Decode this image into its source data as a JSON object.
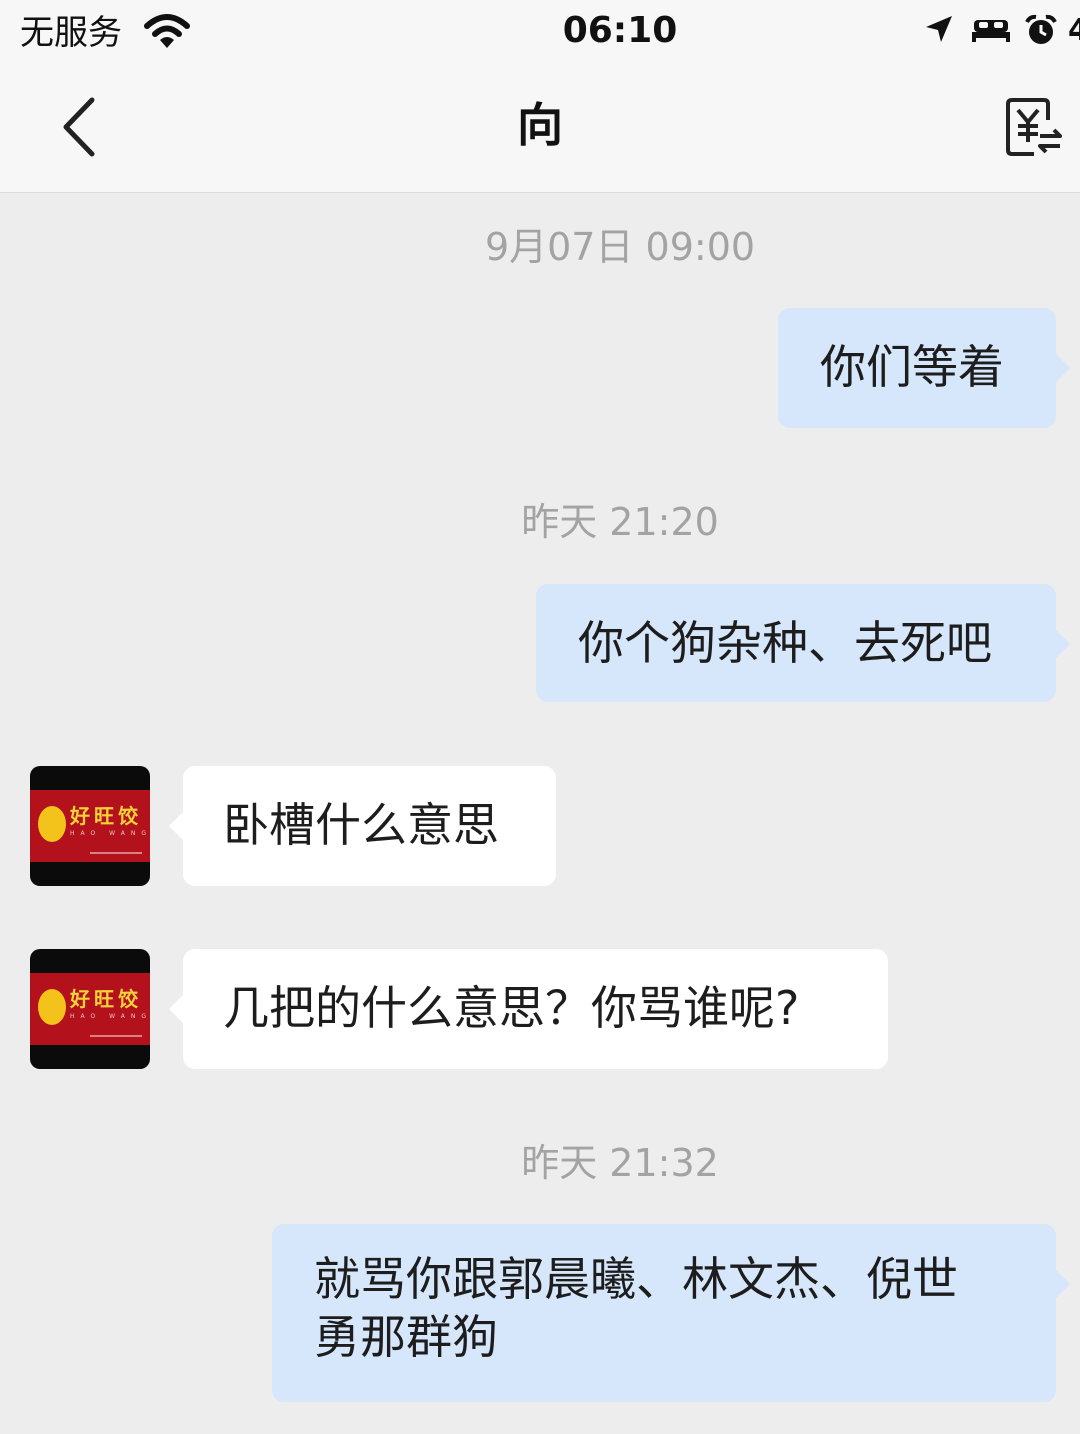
{
  "status_bar": {
    "carrier": "无服务",
    "time": "06:10",
    "wifi_icon": "wifi-icon",
    "location_icon": "location-arrow-icon",
    "sleep_icon": "bed-icon",
    "alarm_icon": "alarm-clock-icon"
  },
  "nav": {
    "back_icon": "chevron-left-icon",
    "title": "向",
    "transfer_icon": "yuan-transfer-icon"
  },
  "colors": {
    "background": "#ededed",
    "bar_background": "#f7f7f7",
    "outgoing_bubble": "#d6e6fb",
    "incoming_bubble": "#ffffff",
    "timestamp_text": "#a3a3a3",
    "avatar_red": "#b3121c",
    "avatar_yellow": "#f4d33a"
  },
  "contact": {
    "avatar_text": "好旺饺",
    "avatar_subtext": "HAO WANG JIAO"
  },
  "messages": [
    {
      "type": "timestamp",
      "text": "9月07日 09:00"
    },
    {
      "type": "outgoing",
      "text": "你们等着"
    },
    {
      "type": "timestamp",
      "text": "昨天 21:20"
    },
    {
      "type": "outgoing",
      "text": "你个狗杂种、去死吧"
    },
    {
      "type": "incoming",
      "text": "卧槽什么意思"
    },
    {
      "type": "incoming",
      "text": "几把的什么意思？你骂谁呢?"
    },
    {
      "type": "timestamp",
      "text": "昨天 21:32"
    },
    {
      "type": "outgoing",
      "lines": [
        "就骂你跟郭晨曦、林文杰、倪世",
        "勇那群狗"
      ]
    }
  ]
}
